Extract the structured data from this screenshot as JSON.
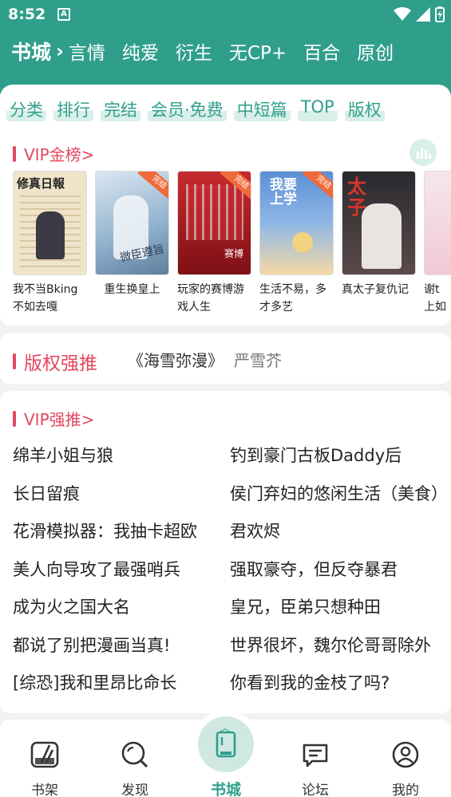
{
  "status_bar": {
    "time": "8:52",
    "notification_letter": "A"
  },
  "top_nav": {
    "brand": "书城",
    "chevron": "›",
    "categories": [
      "言情",
      "纯爱",
      "衍生",
      "无CP+",
      "百合",
      "原创"
    ]
  },
  "chips": [
    "分类",
    "排行",
    "完结",
    "会员·免费",
    "中短篇",
    "TOP",
    "版权"
  ],
  "vip_gold": {
    "title": "VIP金榜>",
    "books": [
      {
        "title": "我不当Bking不如去嘎",
        "finished": false,
        "cover_text": "修真日報"
      },
      {
        "title": "重生换皇上",
        "finished": true,
        "cover_text": "微臣遵旨"
      },
      {
        "title": "玩家的赛博游戏人生",
        "finished": true,
        "cover_text": "赛博"
      },
      {
        "title": "生活不易，多才多艺",
        "finished": true,
        "cover_text": "我要上学"
      },
      {
        "title": "真太子复仇记",
        "finished": false,
        "cover_text": "太子"
      },
      {
        "title": "谢t上如",
        "finished": false,
        "cover_text": ""
      }
    ]
  },
  "copyright": {
    "title": "版权强推",
    "book": "《海雪弥漫》",
    "author": "严雪芥"
  },
  "vip_push": {
    "title": "VIP强推>",
    "left": [
      "绵羊小姐与狼",
      "长日留痕",
      "花滑模拟器：我抽卡超欧",
      "美人向导攻了最强哨兵",
      "成为火之国大名",
      "都说了别把漫画当真!",
      "[综恐]我和里昂比命长"
    ],
    "right": [
      "钓到豪门古板Daddy后",
      "侯门弃妇的悠闲生活（美食）",
      "君欢烬",
      "强取豪夺，但反夺暴君",
      "皇兄，臣弟只想种田",
      "世界很坏，魏尔伦哥哥除外",
      "你看到我的金枝了吗?"
    ]
  },
  "tabs": {
    "shelf": "书架",
    "discover": "发现",
    "store": "书城",
    "forum": "论坛",
    "mine": "我的"
  },
  "colors": {
    "accent": "#2f9f8c",
    "red": "#e4475e"
  }
}
